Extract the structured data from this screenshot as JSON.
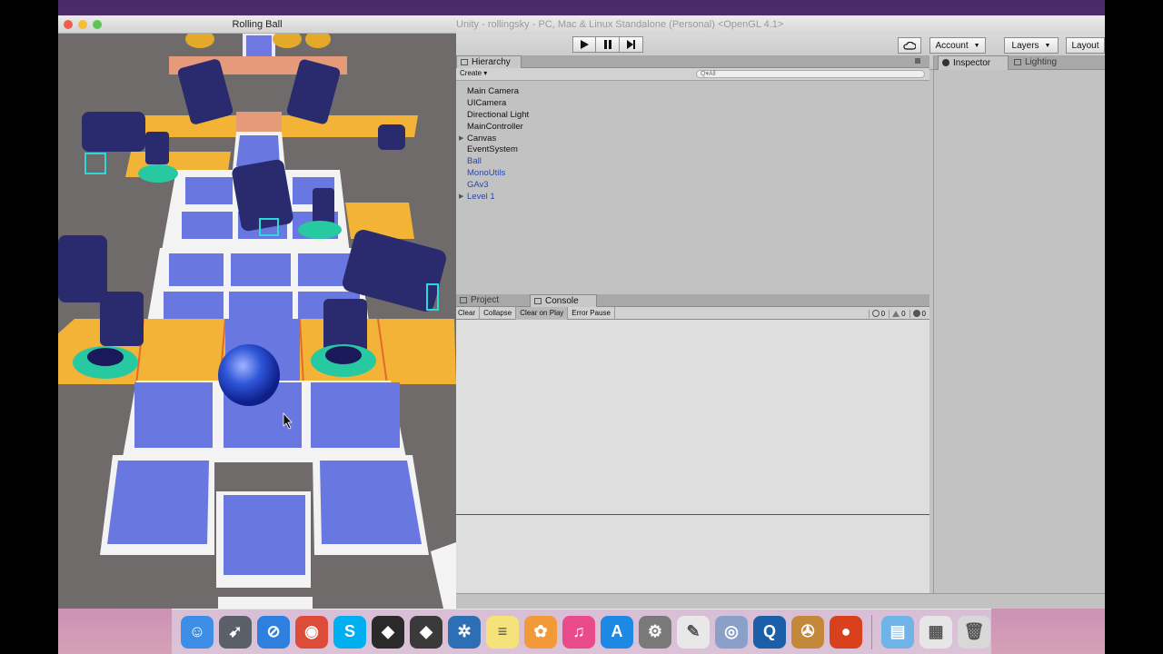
{
  "game_window": {
    "title": "Rolling Ball"
  },
  "unity_window": {
    "title": "Unity - rollingsky - PC, Mac & Linux Standalone (Personal) <OpenGL 4.1>",
    "toolbar": {
      "account_label": "Account",
      "layers_label": "Layers",
      "layout_label": "Layout"
    },
    "hierarchy": {
      "tab_label": "Hierarchy",
      "create_label": "Create",
      "search_placeholder": "Q▾All",
      "items": [
        {
          "label": "Main Camera",
          "prefab": false,
          "foldout": false
        },
        {
          "label": "UICamera",
          "prefab": false,
          "foldout": false
        },
        {
          "label": "Directional Light",
          "prefab": false,
          "foldout": false
        },
        {
          "label": "MainController",
          "prefab": false,
          "foldout": false
        },
        {
          "label": "Canvas",
          "prefab": false,
          "foldout": true
        },
        {
          "label": "EventSystem",
          "prefab": false,
          "foldout": false
        },
        {
          "label": "Ball",
          "prefab": true,
          "foldout": false
        },
        {
          "label": "MonoUtils",
          "prefab": true,
          "foldout": false
        },
        {
          "label": "GAv3",
          "prefab": true,
          "foldout": false
        },
        {
          "label": "Level 1",
          "prefab": true,
          "foldout": true
        }
      ]
    },
    "bottom_tabs": {
      "project_label": "Project",
      "console_label": "Console"
    },
    "console": {
      "clear_label": "Clear",
      "collapse_label": "Collapse",
      "clear_on_play_label": "Clear on Play",
      "error_pause_label": "Error Pause",
      "info_count": "0",
      "warning_count": "0",
      "error_count": "0"
    },
    "inspector": {
      "tab_label": "Inspector",
      "lighting_label": "Lighting"
    }
  },
  "dock": {
    "apps": [
      {
        "name": "Finder",
        "icon": "finder-icon",
        "color": "#3c8ee6",
        "glyph": "☺"
      },
      {
        "name": "Launchpad",
        "icon": "launchpad-icon",
        "color": "#5a5f68",
        "glyph": "➹"
      },
      {
        "name": "Safari",
        "icon": "safari-icon",
        "color": "#2f7fe0",
        "glyph": "⊘"
      },
      {
        "name": "Chrome",
        "icon": "chrome-icon",
        "color": "#dd4b39",
        "glyph": "◉"
      },
      {
        "name": "Skype",
        "icon": "skype-icon",
        "color": "#00aff0",
        "glyph": "S"
      },
      {
        "name": "Unity",
        "icon": "unity-icon",
        "color": "#2a2a2a",
        "glyph": "◆"
      },
      {
        "name": "Unity",
        "icon": "unity-icon-2",
        "color": "#3a3a3a",
        "glyph": "◆"
      },
      {
        "name": "Xcode",
        "icon": "xcode-icon",
        "color": "#2c6fb5",
        "glyph": "✲"
      },
      {
        "name": "Notes",
        "icon": "notes-icon",
        "color": "#f5e27a",
        "glyph": "≡"
      },
      {
        "name": "Photos",
        "icon": "photos-icon",
        "color": "#f29a3a",
        "glyph": "✿"
      },
      {
        "name": "iTunes",
        "icon": "itunes-icon",
        "color": "#e84a8a",
        "glyph": "♫"
      },
      {
        "name": "App Store",
        "icon": "app-store-icon",
        "color": "#1e88e5",
        "glyph": "A"
      },
      {
        "name": "System Preferences",
        "icon": "system-preferences-icon",
        "color": "#7a7a7a",
        "glyph": "⚙"
      },
      {
        "name": "TextEdit",
        "icon": "textedit-icon",
        "color": "#e8e8e8",
        "glyph": "✎"
      },
      {
        "name": "Preview",
        "icon": "preview-icon",
        "color": "#8aa0c8",
        "glyph": "◎"
      },
      {
        "name": "QuickTime",
        "icon": "quicktime-icon",
        "color": "#1a5fa8",
        "glyph": "Q"
      },
      {
        "name": "Photo Booth",
        "icon": "movie-icon",
        "color": "#c4883a",
        "glyph": "✇"
      },
      {
        "name": "Rolling Ball",
        "icon": "game-app-icon",
        "color": "#d9401e",
        "glyph": "●"
      }
    ],
    "right": [
      {
        "name": "Downloads",
        "icon": "folder-icon",
        "color": "#6fb3e8",
        "glyph": "▤"
      },
      {
        "name": "Documents",
        "icon": "documents-icon",
        "color": "#e6e6e6",
        "glyph": "▦"
      },
      {
        "name": "Trash",
        "icon": "trash-icon",
        "color": "#d8d8d8",
        "glyph": "🗑"
      }
    ]
  }
}
